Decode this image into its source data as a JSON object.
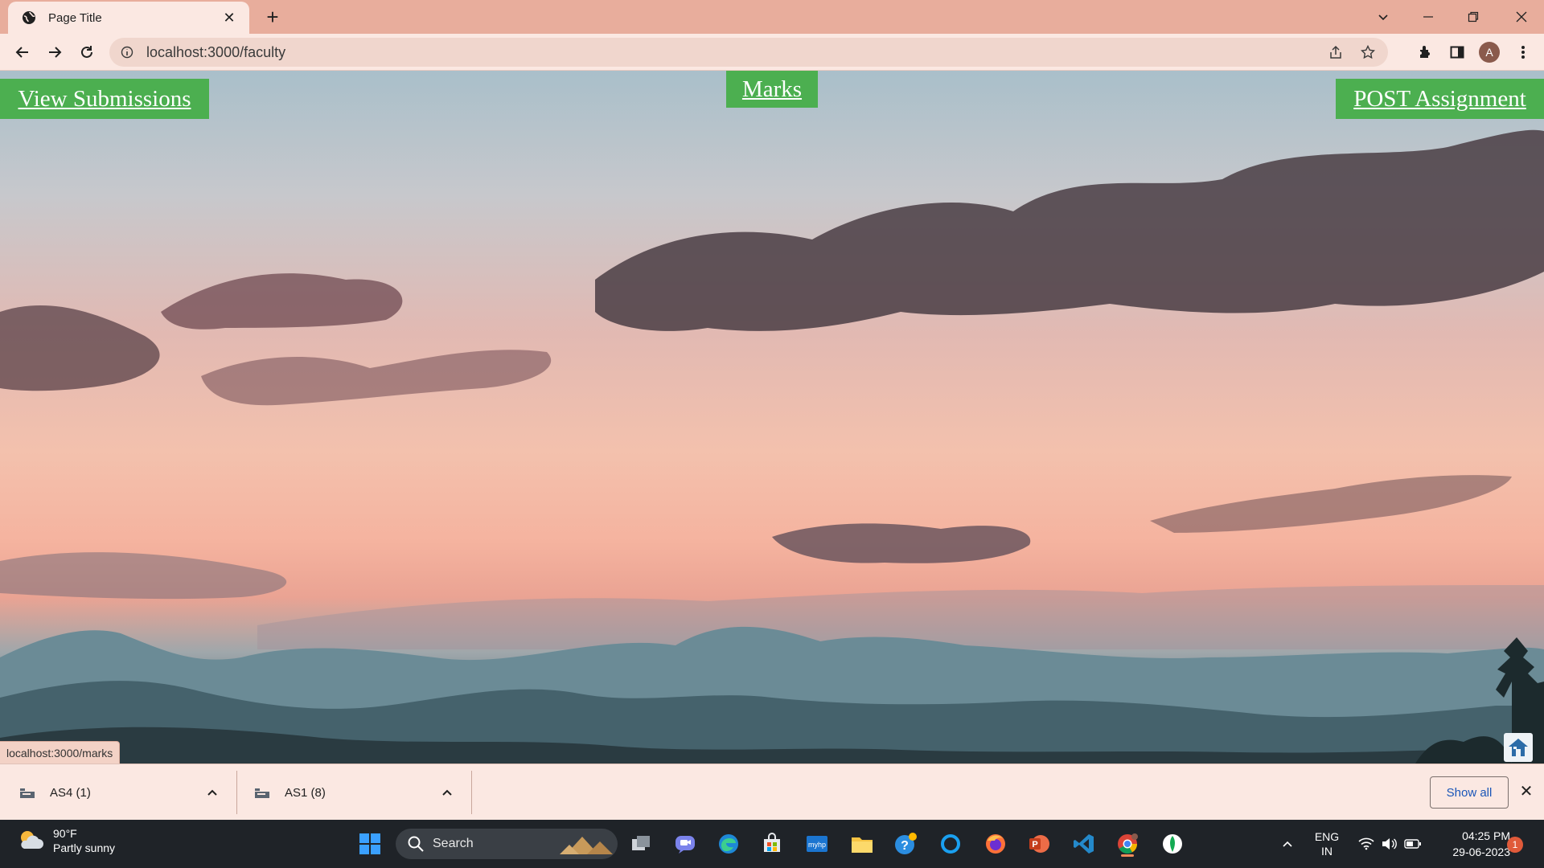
{
  "browser": {
    "tab_title": "Page Title",
    "new_tab_label": "+",
    "tab_close": "✕",
    "url": "localhost:3000/faculty",
    "profile_initial": "A"
  },
  "page": {
    "links": {
      "view_submissions": "View Submissions",
      "marks": "Marks",
      "post_assignment": "POST Assignment"
    },
    "hover_status_url": "localhost:3000/marks",
    "link_color": "#4caf50"
  },
  "downloads": {
    "items": [
      {
        "name": "AS4 (1)"
      },
      {
        "name": "AS1 (8)"
      }
    ],
    "show_all": "Show all",
    "close": "✕"
  },
  "taskbar": {
    "weather": {
      "temp": "90°F",
      "condition": "Partly sunny"
    },
    "search_label": "Search",
    "language": {
      "line1": "ENG",
      "line2": "IN"
    },
    "time": "04:25 PM",
    "date": "29-06-2023",
    "notification_count": "1"
  }
}
